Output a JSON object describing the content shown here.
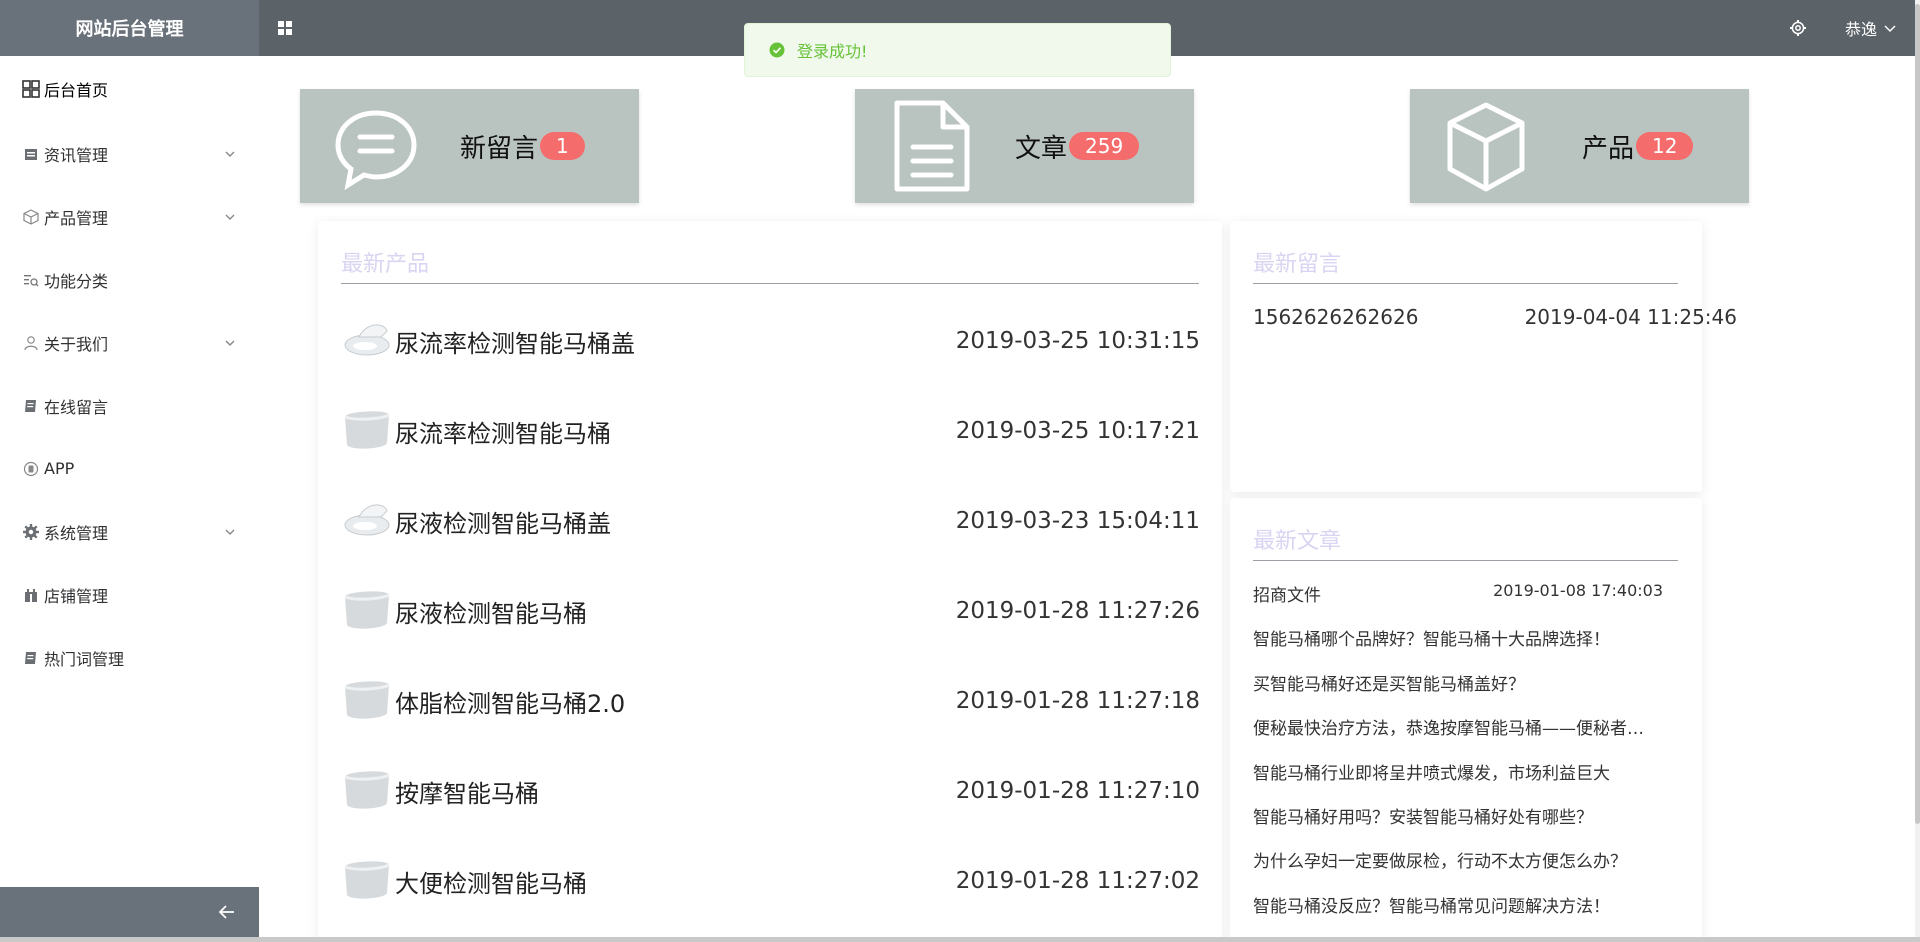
{
  "sidebar": {
    "title": "网站后台管理",
    "items": [
      {
        "label": "后台首页",
        "icon": "dashboard-icon",
        "has_children": false
      },
      {
        "label": "资讯管理",
        "icon": "news-icon",
        "has_children": true
      },
      {
        "label": "产品管理",
        "icon": "box-icon",
        "has_children": true
      },
      {
        "label": "功能分类",
        "icon": "list-search-icon",
        "has_children": false
      },
      {
        "label": "关于我们",
        "icon": "user-icon",
        "has_children": true
      },
      {
        "label": "在线留言",
        "icon": "document-icon",
        "has_children": false
      },
      {
        "label": "APP",
        "icon": "app-icon",
        "has_children": false
      },
      {
        "label": "系统管理",
        "icon": "gear-icon",
        "has_children": true
      },
      {
        "label": "店铺管理",
        "icon": "shop-icon",
        "has_children": false
      },
      {
        "label": "热门词管理",
        "icon": "document-icon",
        "has_children": false
      }
    ]
  },
  "header": {
    "user_name": "恭逸"
  },
  "toast": {
    "message": "登录成功!",
    "type": "success"
  },
  "stats": [
    {
      "label": "新留言",
      "count": "1",
      "icon": "chat-bubble-icon"
    },
    {
      "label": "文章",
      "count": "259",
      "icon": "file-icon"
    },
    {
      "label": "产品",
      "count": "12",
      "icon": "cube-icon"
    }
  ],
  "latest_products": {
    "title": "最新产品",
    "items": [
      {
        "name": "尿流率检测智能马桶盖",
        "date": "2019-03-25 10:31:15",
        "thumb": "toilet-seat-icon"
      },
      {
        "name": "尿流率检测智能马桶",
        "date": "2019-03-25 10:17:21",
        "thumb": "toilet-icon"
      },
      {
        "name": "尿液检测智能马桶盖",
        "date": "2019-03-23 15:04:11",
        "thumb": "toilet-seat-icon"
      },
      {
        "name": "尿液检测智能马桶",
        "date": "2019-01-28 11:27:26",
        "thumb": "toilet-icon"
      },
      {
        "name": "体脂检测智能马桶2.0",
        "date": "2019-01-28 11:27:18",
        "thumb": "toilet-icon"
      },
      {
        "name": "按摩智能马桶",
        "date": "2019-01-28 11:27:10",
        "thumb": "toilet-icon"
      },
      {
        "name": "大便检测智能马桶",
        "date": "2019-01-28 11:27:02",
        "thumb": "toilet-icon"
      }
    ]
  },
  "latest_messages": {
    "title": "最新留言",
    "items": [
      {
        "phone": "1562626262626",
        "date": "2019-04-04 11:25:46"
      }
    ]
  },
  "latest_articles": {
    "title": "最新文章",
    "first": {
      "title": "招商文件",
      "date": "2019-01-08 17:40:03"
    },
    "items": [
      "智能马桶哪个品牌好？智能马桶十大品牌选择！",
      "买智能马桶好还是买智能马桶盖好？",
      "便秘最快治疗方法，恭逸按摩智能马桶——便秘者的...",
      "智能马桶行业即将呈井喷式爆发，市场利益巨大",
      "智能马桶好用吗？安装智能马桶好处有哪些？",
      "为什么孕妇一定要做尿检，行动不太方便怎么办？",
      "智能马桶没反应？智能马桶常见问题解决方法！"
    ]
  },
  "colors": {
    "header_bg": "#5b6268",
    "sidebar_header_bg": "#69717a",
    "stat_card_bg": "#b9c3bf",
    "badge_bg": "#f56c6c",
    "panel_title": "#d8d4f2",
    "toast_bg": "#f0f9eb",
    "toast_text": "#67c23a"
  }
}
